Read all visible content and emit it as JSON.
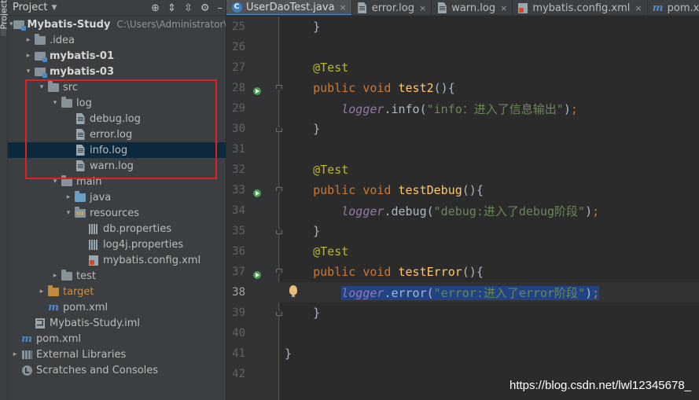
{
  "sidebar_stripe": {
    "label": "Project"
  },
  "project_panel": {
    "title": "Project",
    "icons": [
      "globe-icon",
      "collapse-icon",
      "expand-icon",
      "gear-icon",
      "hide-icon"
    ],
    "tree": [
      {
        "label": "Mybatis-Study",
        "path": "C:\\Users\\Administrator\\Id",
        "arrow": "down",
        "icon": "module",
        "bold": true
      },
      {
        "label": ".idea",
        "arrow": "right",
        "icon": "folder"
      },
      {
        "label": "mybatis-01",
        "arrow": "right",
        "icon": "module",
        "bold": true
      },
      {
        "label": "mybatis-03",
        "arrow": "down",
        "icon": "module",
        "bold": true
      },
      {
        "label": "src",
        "arrow": "down",
        "icon": "folder"
      },
      {
        "label": "log",
        "arrow": "down",
        "icon": "folder"
      },
      {
        "label": "debug.log",
        "arrow": "none",
        "icon": "file"
      },
      {
        "label": "error.log",
        "arrow": "none",
        "icon": "file"
      },
      {
        "label": "info.log",
        "arrow": "none",
        "icon": "file",
        "selected": true
      },
      {
        "label": "warn.log",
        "arrow": "none",
        "icon": "file"
      },
      {
        "label": "main",
        "arrow": "down",
        "icon": "folder"
      },
      {
        "label": "java",
        "arrow": "right",
        "icon": "folder-blue"
      },
      {
        "label": "resources",
        "arrow": "down",
        "icon": "folder-res"
      },
      {
        "label": "db.properties",
        "arrow": "none",
        "icon": "props"
      },
      {
        "label": "log4j.properties",
        "arrow": "none",
        "icon": "props"
      },
      {
        "label": "mybatis.config.xml",
        "arrow": "none",
        "icon": "xml"
      },
      {
        "label": "test",
        "arrow": "right",
        "icon": "folder"
      },
      {
        "label": "target",
        "arrow": "right",
        "icon": "folder-orange",
        "orange": true
      },
      {
        "label": "pom.xml",
        "arrow": "none",
        "icon": "maven"
      },
      {
        "label": "Mybatis-Study.iml",
        "arrow": "none",
        "icon": "iml"
      },
      {
        "label": "pom.xml",
        "arrow": "none",
        "icon": "maven"
      },
      {
        "label": "External Libraries",
        "arrow": "right",
        "icon": "libs"
      },
      {
        "label": "Scratches and Consoles",
        "arrow": "none",
        "icon": "scratch"
      }
    ]
  },
  "tabs": [
    {
      "label": "UserDaoTest.java",
      "icon": "class-icon",
      "active": true
    },
    {
      "label": "error.log",
      "icon": "file-icon"
    },
    {
      "label": "warn.log",
      "icon": "file-icon"
    },
    {
      "label": "mybatis.config.xml",
      "icon": "xml-icon"
    },
    {
      "label": "pom.xml (N",
      "icon": "maven-icon"
    }
  ],
  "code_lines": [
    {
      "num": "25",
      "tokens": [
        {
          "t": "    }",
          "c": "plain"
        }
      ]
    },
    {
      "num": "26",
      "tokens": []
    },
    {
      "num": "27",
      "tokens": [
        {
          "t": "    ",
          "c": "plain"
        },
        {
          "t": "@Test",
          "c": "ann"
        }
      ]
    },
    {
      "num": "28",
      "run": true,
      "fold": "down",
      "tokens": [
        {
          "t": "    ",
          "c": "plain"
        },
        {
          "t": "public void ",
          "c": "kw"
        },
        {
          "t": "test2",
          "c": "fn"
        },
        {
          "t": "(){",
          "c": "plain"
        }
      ]
    },
    {
      "num": "29",
      "tokens": [
        {
          "t": "        ",
          "c": "plain"
        },
        {
          "t": "logger",
          "c": "fld"
        },
        {
          "t": ".info(",
          "c": "plain"
        },
        {
          "t": "\"info：进入了信息输出\"",
          "c": "str"
        },
        {
          "t": ")",
          "c": "plain"
        },
        {
          "t": ";",
          "c": "kw"
        }
      ]
    },
    {
      "num": "30",
      "fold": "up",
      "tokens": [
        {
          "t": "    }",
          "c": "plain"
        }
      ]
    },
    {
      "num": "31",
      "tokens": []
    },
    {
      "num": "32",
      "tokens": [
        {
          "t": "    ",
          "c": "plain"
        },
        {
          "t": "@Test",
          "c": "ann"
        }
      ]
    },
    {
      "num": "33",
      "run": true,
      "fold": "down",
      "tokens": [
        {
          "t": "    ",
          "c": "plain"
        },
        {
          "t": "public void ",
          "c": "kw"
        },
        {
          "t": "testDebug",
          "c": "fn"
        },
        {
          "t": "(){",
          "c": "plain"
        }
      ]
    },
    {
      "num": "34",
      "tokens": [
        {
          "t": "        ",
          "c": "plain"
        },
        {
          "t": "logger",
          "c": "fld"
        },
        {
          "t": ".debug(",
          "c": "plain"
        },
        {
          "t": "\"debug:进入了debug阶段\"",
          "c": "str"
        },
        {
          "t": ")",
          "c": "plain"
        },
        {
          "t": ";",
          "c": "kw"
        }
      ]
    },
    {
      "num": "35",
      "fold": "up",
      "tokens": [
        {
          "t": "    }",
          "c": "plain"
        }
      ]
    },
    {
      "num": "36",
      "tokens": [
        {
          "t": "    ",
          "c": "plain"
        },
        {
          "t": "@Test",
          "c": "ann"
        }
      ]
    },
    {
      "num": "37",
      "run": true,
      "fold": "down",
      "tokens": [
        {
          "t": "    ",
          "c": "plain"
        },
        {
          "t": "public void ",
          "c": "kw"
        },
        {
          "t": "testError",
          "c": "fn"
        },
        {
          "t": "(){",
          "c": "plain"
        }
      ]
    },
    {
      "num": "38",
      "current": true,
      "bulb": true,
      "tokens": [
        {
          "t": "        ",
          "c": "plain"
        },
        {
          "t": "logger",
          "c": "fld sel"
        },
        {
          "t": ".error(",
          "c": "plain sel"
        },
        {
          "t": "\"error:进入了error阶段\"",
          "c": "str sel"
        },
        {
          "t": ")",
          "c": "plain sel"
        },
        {
          "t": ";",
          "c": "kw sel"
        }
      ]
    },
    {
      "num": "39",
      "fold": "up",
      "tokens": [
        {
          "t": "    }",
          "c": "plain"
        }
      ]
    },
    {
      "num": "40",
      "tokens": []
    },
    {
      "num": "41",
      "tokens": [
        {
          "t": "}",
          "c": "plain"
        }
      ]
    },
    {
      "num": "42",
      "tokens": []
    }
  ],
  "watermark": "https://blog.csdn.net/lwl12345678_"
}
